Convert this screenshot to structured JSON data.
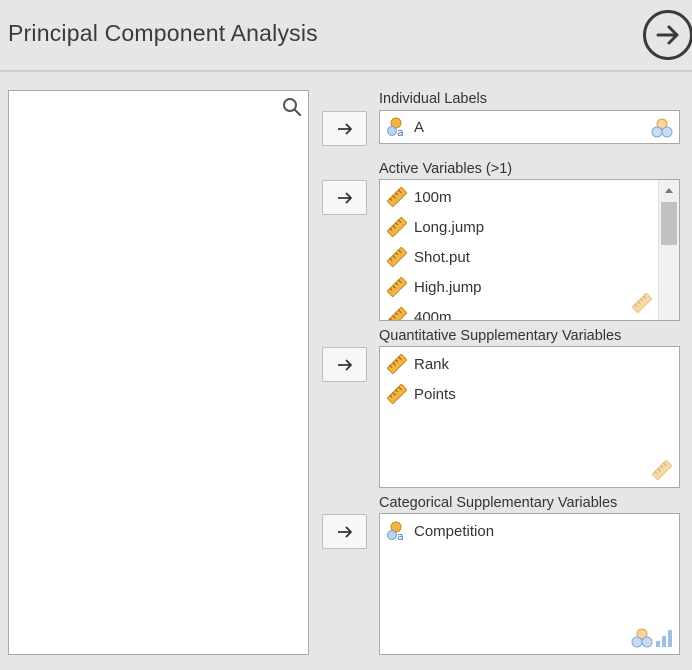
{
  "title": "Principal Component Analysis",
  "labels": {
    "individual": "Individual Labels",
    "active": "Active Variables (>1)",
    "quantitative": "Quantitative Supplementary Variables",
    "categorical": "Categorical Supplementary Variables"
  },
  "individual_item": "A",
  "active_items": [
    "100m",
    "Long.jump",
    "Shot.put",
    "High.jump",
    "400m"
  ],
  "quantitative_items": [
    "Rank",
    "Points"
  ],
  "categorical_items": [
    "Competition"
  ],
  "colors": {
    "ruler": "#f2b545",
    "nominal_circle": "#f2b545",
    "nominal_letter": "#3d7fc4"
  }
}
